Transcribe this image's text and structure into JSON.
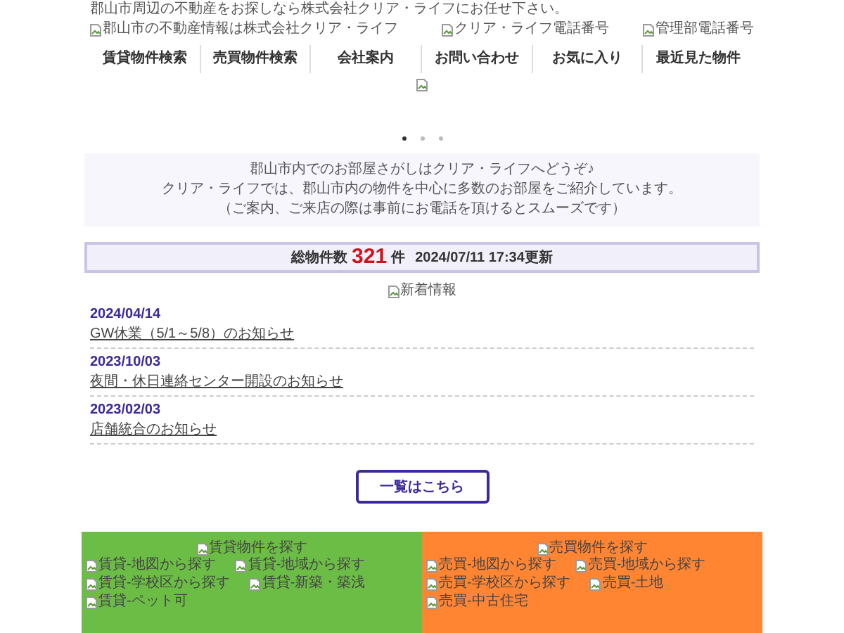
{
  "tagline": "郡山市周辺の不動産をお探しなら株式会社クリア・ライフにお任せ下さい。",
  "header_images": {
    "logo": "郡山市の不動産情報は株式会社クリア・ライフ",
    "phones": [
      "クリア・ライフ電話番号",
      "管理部電話番号"
    ]
  },
  "nav": [
    "賃貸物件検索",
    "売買物件検索",
    "会社案内",
    "お問い合わせ",
    "お気に入り",
    "最近見た物件"
  ],
  "slider_dots": [
    {
      "selected": true
    },
    {
      "selected": false
    },
    {
      "selected": false
    }
  ],
  "intro": [
    "郡山市内でのお部屋さがしはクリア・ライフへどうぞ♪",
    "クリア・ライフでは、郡山市内の物件を中心に多数のお部屋をご紹介しています。",
    "（ご案内、ご来店の際は事前にお電話を頂けるとスムーズです）"
  ],
  "count": {
    "label": "総物件数",
    "number": "321",
    "unit": "件",
    "updated": "2024/07/11 17:34更新"
  },
  "news_heading": "新着情報",
  "news": [
    {
      "date": "2024/04/14",
      "title": "GW休業（5/1～5/8）のお知らせ"
    },
    {
      "date": "2023/10/03",
      "title": "夜間・休日連絡センター開設のお知らせ"
    },
    {
      "date": "2023/02/03",
      "title": "店舗統合のお知らせ"
    }
  ],
  "more_button": "一覧はこちら",
  "footer_sections": [
    {
      "kind": "rent",
      "heading": "賃貸物件を探す",
      "items": [
        "賃貸-地図から探す",
        "賃貸-地域から探す",
        "賃貸-学校区から探す",
        "賃貸-新築・築浅",
        "賃貸-ペット可"
      ]
    },
    {
      "kind": "sale",
      "heading": "売買物件を探す",
      "items": [
        "売買-地図から探す",
        "売買-地域から探す",
        "売買-学校区から探す",
        "売買-土地",
        "売買-中古住宅"
      ]
    }
  ]
}
